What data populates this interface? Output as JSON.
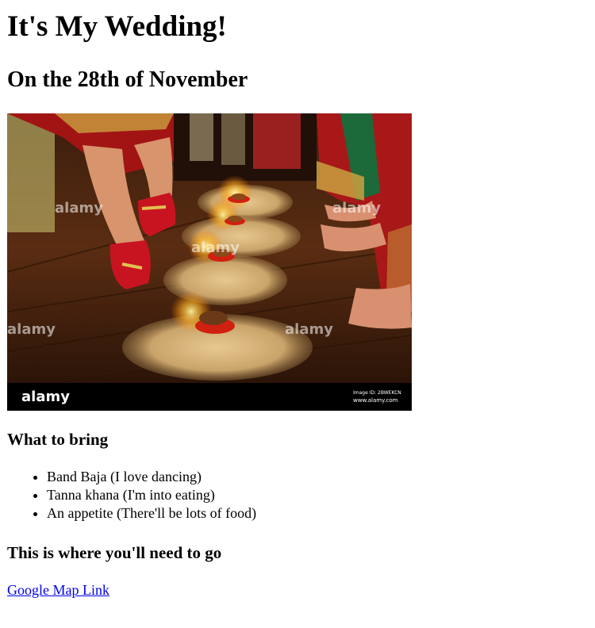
{
  "heading": "It's My Wedding!",
  "subheading": "On the 28th of November",
  "photo": {
    "watermark_brand": "alamy",
    "footer_logo": "alamy",
    "image_id": "Image ID: 2BWEKCN",
    "site": "www.alamy.com"
  },
  "bring": {
    "title": "What to bring",
    "items": [
      "Band Baja (I love dancing)",
      "Tanna khana (I'm into eating)",
      "An appetite (There'll be lots of food)"
    ]
  },
  "where": {
    "title": "This is where you'll need to go",
    "link_text": "Google Map Link"
  },
  "colors": {
    "link": "#0000ee",
    "text": "#000000"
  }
}
